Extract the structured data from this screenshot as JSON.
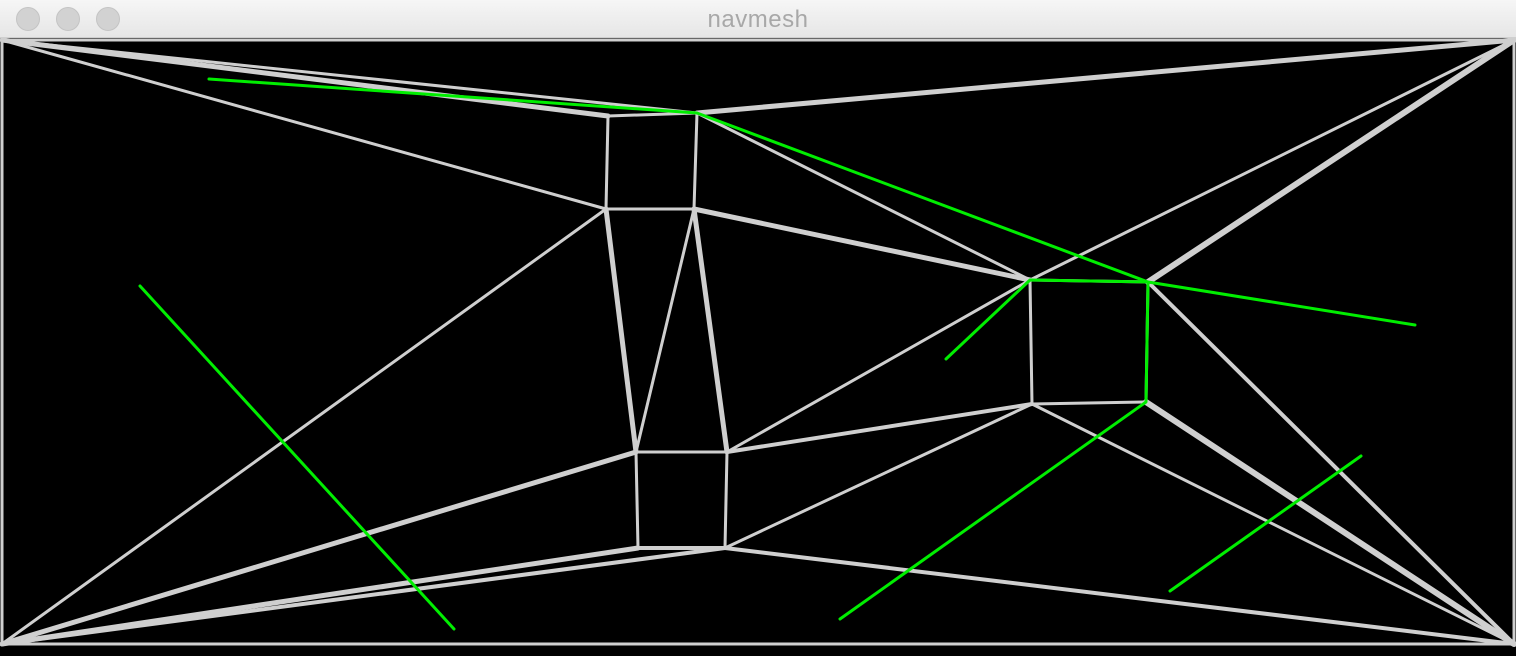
{
  "window": {
    "title": "navmesh",
    "controls": [
      "close",
      "minimize",
      "zoom"
    ]
  },
  "scene": {
    "background": "#000000",
    "mesh_color": "#cccccc",
    "path_color": "#00ee00",
    "obstacles": 4,
    "paths": 5
  }
}
